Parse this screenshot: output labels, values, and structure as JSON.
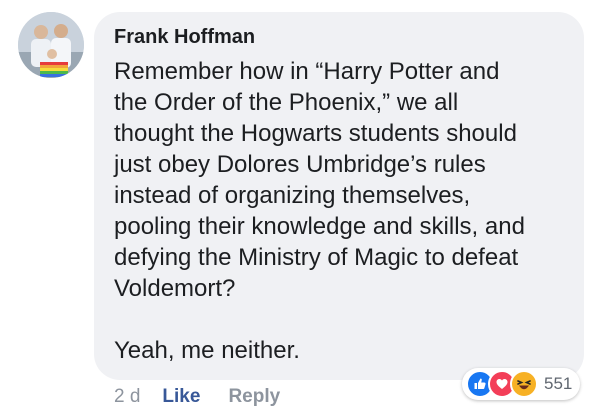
{
  "comment": {
    "author": "Frank Hoffman",
    "text": "Remember how in “Harry Potter and\nthe Order of the Phoenix,” we all\nthought the Hogwarts students should\njust obey Dolores Umbridge’s rules\ninstead of organizing themselves,\npooling their knowledge and skills, and\ndefying the Ministry of Magic to defeat\nVoldemort?\n\nYeah, me neither.",
    "timestamp": "2 d",
    "like_label": "Like",
    "reply_label": "Reply",
    "reaction_count": "551",
    "reactions": [
      "like-icon",
      "love-icon",
      "haha-icon"
    ]
  },
  "colors": {
    "bubble": "#f0f1f4",
    "link_blue": "#385898",
    "muted_gray": "#8d949e",
    "like_blue": "#1877f2",
    "love_red": "#f33e58",
    "haha_yellow": "#f7b125"
  }
}
